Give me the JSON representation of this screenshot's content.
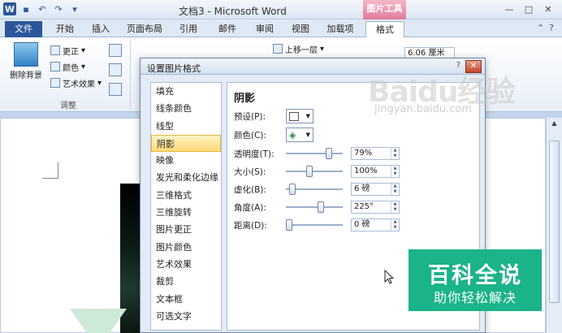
{
  "titlebar": {
    "title": "文档3 - Microsoft Word",
    "context_tools": "图片工具",
    "qat_icons": [
      "word-logo",
      "save-icon",
      "undo-icon",
      "redo-icon",
      "customize-icon"
    ]
  },
  "tabs": [
    "文件",
    "开始",
    "插入",
    "页面布局",
    "引用",
    "邮件",
    "审阅",
    "视图",
    "加载项",
    "格式"
  ],
  "active_tab": "格式",
  "ribbon": {
    "remove_bg": "删除背景",
    "corrections": "更正",
    "color": "颜色",
    "artistic": "艺术效果",
    "group_adjust": "调整",
    "bring_forward": "上移一层",
    "size_value": "6.06 厘米"
  },
  "dialog": {
    "title": "设置图片格式",
    "help": "?",
    "close": "✕",
    "nav": [
      "填充",
      "线条颜色",
      "线型",
      "阴影",
      "映像",
      "发光和柔化边缘",
      "三维格式",
      "三维旋转",
      "图片更正",
      "图片颜色",
      "艺术效果",
      "裁剪",
      "文本框",
      "可选文字"
    ],
    "selected_nav": "阴影",
    "panel_title": "阴影",
    "preset_label": "预设(P):",
    "color_label": "颜色(C):",
    "rows": [
      {
        "label": "透明度(T):",
        "value": "79%",
        "level": 0.79
      },
      {
        "label": "大小(S):",
        "value": "100%",
        "level": 0.4
      },
      {
        "label": "虚化(B):",
        "value": "6 磅",
        "level": 0.06
      },
      {
        "label": "角度(A):",
        "value": "225°",
        "level": 0.625
      },
      {
        "label": "距离(D):",
        "value": "0 磅",
        "level": 0.0
      }
    ]
  },
  "watermark": {
    "baidu": "Baidu经验",
    "url": "jingyan.baidu.com",
    "badge_title": "百科全说",
    "badge_sub": "助你轻松解决",
    "badge_color": "#1bb38a"
  }
}
